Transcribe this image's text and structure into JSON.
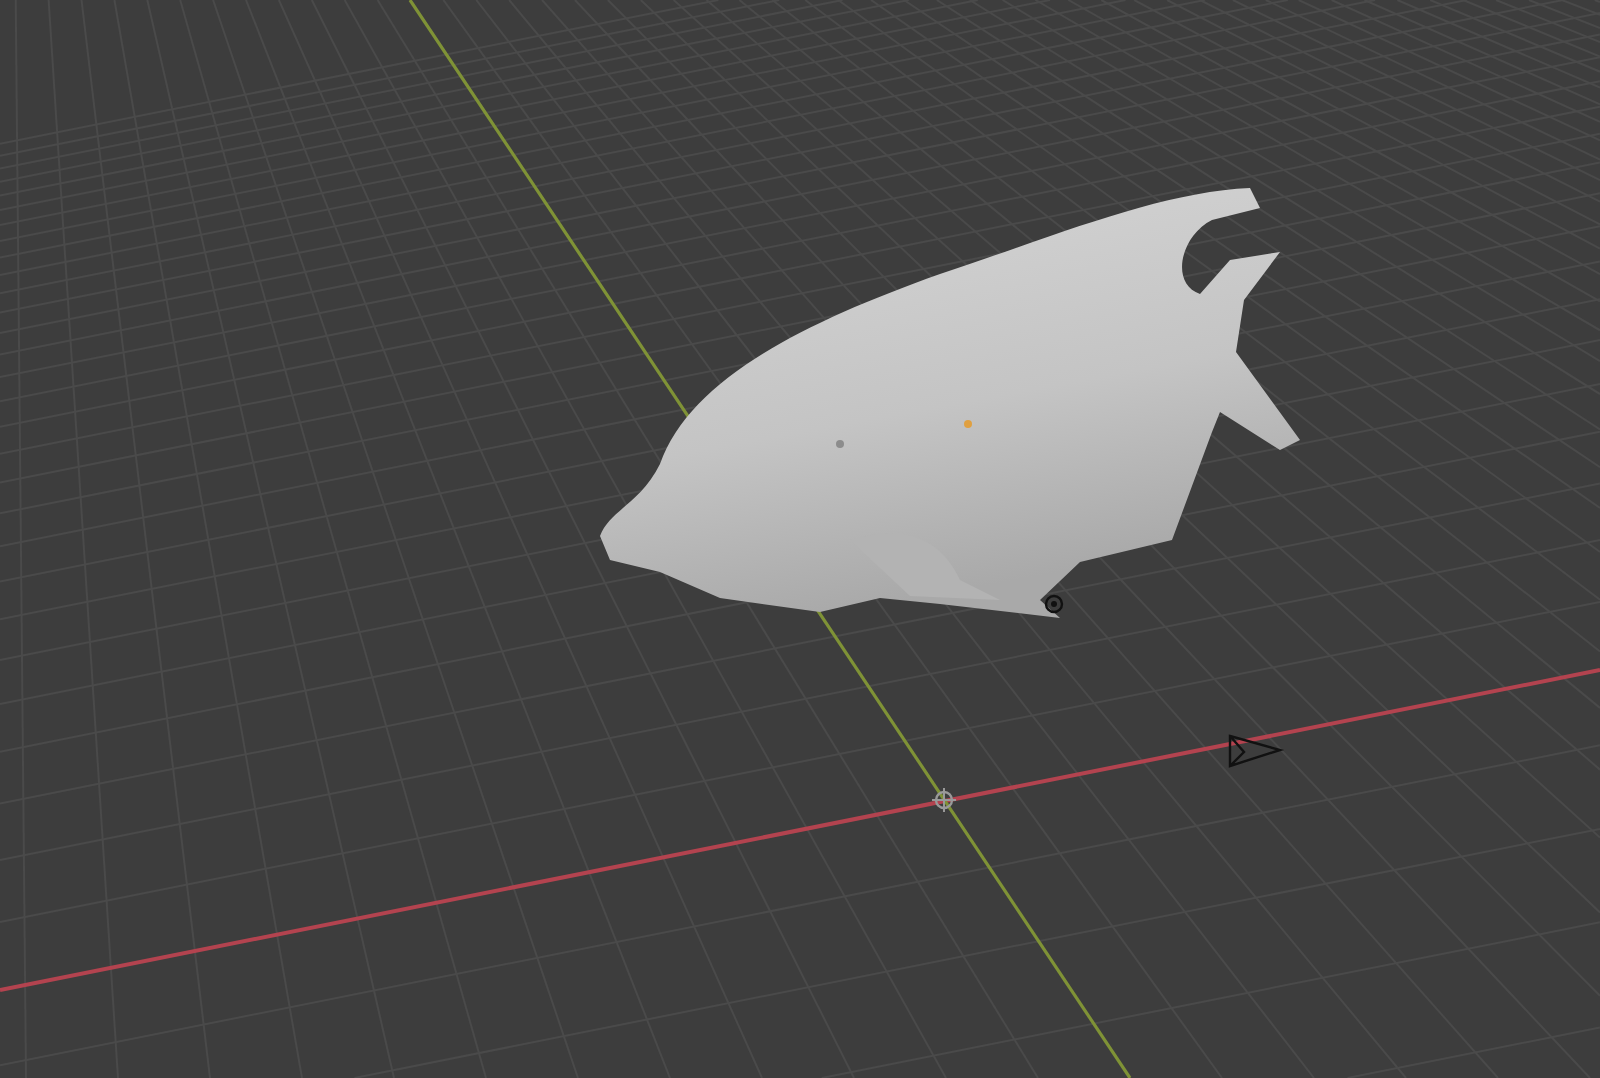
{
  "viewport": {
    "objects": [
      {
        "kind": "grid"
      },
      {
        "kind": "axes"
      },
      {
        "kind": "mesh"
      },
      {
        "kind": "light"
      },
      {
        "kind": "camera"
      },
      {
        "kind": "origin"
      }
    ]
  }
}
